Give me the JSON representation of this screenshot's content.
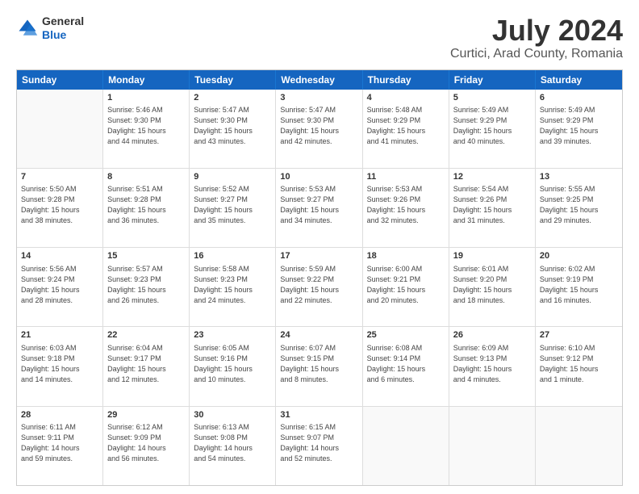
{
  "header": {
    "logo_general": "General",
    "logo_blue": "Blue",
    "main_title": "July 2024",
    "subtitle": "Curtici, Arad County, Romania"
  },
  "days_of_week": [
    "Sunday",
    "Monday",
    "Tuesday",
    "Wednesday",
    "Thursday",
    "Friday",
    "Saturday"
  ],
  "weeks": [
    [
      {
        "day": "",
        "info": ""
      },
      {
        "day": "1",
        "info": "Sunrise: 5:46 AM\nSunset: 9:30 PM\nDaylight: 15 hours\nand 44 minutes."
      },
      {
        "day": "2",
        "info": "Sunrise: 5:47 AM\nSunset: 9:30 PM\nDaylight: 15 hours\nand 43 minutes."
      },
      {
        "day": "3",
        "info": "Sunrise: 5:47 AM\nSunset: 9:30 PM\nDaylight: 15 hours\nand 42 minutes."
      },
      {
        "day": "4",
        "info": "Sunrise: 5:48 AM\nSunset: 9:29 PM\nDaylight: 15 hours\nand 41 minutes."
      },
      {
        "day": "5",
        "info": "Sunrise: 5:49 AM\nSunset: 9:29 PM\nDaylight: 15 hours\nand 40 minutes."
      },
      {
        "day": "6",
        "info": "Sunrise: 5:49 AM\nSunset: 9:29 PM\nDaylight: 15 hours\nand 39 minutes."
      }
    ],
    [
      {
        "day": "7",
        "info": "Sunrise: 5:50 AM\nSunset: 9:28 PM\nDaylight: 15 hours\nand 38 minutes."
      },
      {
        "day": "8",
        "info": "Sunrise: 5:51 AM\nSunset: 9:28 PM\nDaylight: 15 hours\nand 36 minutes."
      },
      {
        "day": "9",
        "info": "Sunrise: 5:52 AM\nSunset: 9:27 PM\nDaylight: 15 hours\nand 35 minutes."
      },
      {
        "day": "10",
        "info": "Sunrise: 5:53 AM\nSunset: 9:27 PM\nDaylight: 15 hours\nand 34 minutes."
      },
      {
        "day": "11",
        "info": "Sunrise: 5:53 AM\nSunset: 9:26 PM\nDaylight: 15 hours\nand 32 minutes."
      },
      {
        "day": "12",
        "info": "Sunrise: 5:54 AM\nSunset: 9:26 PM\nDaylight: 15 hours\nand 31 minutes."
      },
      {
        "day": "13",
        "info": "Sunrise: 5:55 AM\nSunset: 9:25 PM\nDaylight: 15 hours\nand 29 minutes."
      }
    ],
    [
      {
        "day": "14",
        "info": "Sunrise: 5:56 AM\nSunset: 9:24 PM\nDaylight: 15 hours\nand 28 minutes."
      },
      {
        "day": "15",
        "info": "Sunrise: 5:57 AM\nSunset: 9:23 PM\nDaylight: 15 hours\nand 26 minutes."
      },
      {
        "day": "16",
        "info": "Sunrise: 5:58 AM\nSunset: 9:23 PM\nDaylight: 15 hours\nand 24 minutes."
      },
      {
        "day": "17",
        "info": "Sunrise: 5:59 AM\nSunset: 9:22 PM\nDaylight: 15 hours\nand 22 minutes."
      },
      {
        "day": "18",
        "info": "Sunrise: 6:00 AM\nSunset: 9:21 PM\nDaylight: 15 hours\nand 20 minutes."
      },
      {
        "day": "19",
        "info": "Sunrise: 6:01 AM\nSunset: 9:20 PM\nDaylight: 15 hours\nand 18 minutes."
      },
      {
        "day": "20",
        "info": "Sunrise: 6:02 AM\nSunset: 9:19 PM\nDaylight: 15 hours\nand 16 minutes."
      }
    ],
    [
      {
        "day": "21",
        "info": "Sunrise: 6:03 AM\nSunset: 9:18 PM\nDaylight: 15 hours\nand 14 minutes."
      },
      {
        "day": "22",
        "info": "Sunrise: 6:04 AM\nSunset: 9:17 PM\nDaylight: 15 hours\nand 12 minutes."
      },
      {
        "day": "23",
        "info": "Sunrise: 6:05 AM\nSunset: 9:16 PM\nDaylight: 15 hours\nand 10 minutes."
      },
      {
        "day": "24",
        "info": "Sunrise: 6:07 AM\nSunset: 9:15 PM\nDaylight: 15 hours\nand 8 minutes."
      },
      {
        "day": "25",
        "info": "Sunrise: 6:08 AM\nSunset: 9:14 PM\nDaylight: 15 hours\nand 6 minutes."
      },
      {
        "day": "26",
        "info": "Sunrise: 6:09 AM\nSunset: 9:13 PM\nDaylight: 15 hours\nand 4 minutes."
      },
      {
        "day": "27",
        "info": "Sunrise: 6:10 AM\nSunset: 9:12 PM\nDaylight: 15 hours\nand 1 minute."
      }
    ],
    [
      {
        "day": "28",
        "info": "Sunrise: 6:11 AM\nSunset: 9:11 PM\nDaylight: 14 hours\nand 59 minutes."
      },
      {
        "day": "29",
        "info": "Sunrise: 6:12 AM\nSunset: 9:09 PM\nDaylight: 14 hours\nand 56 minutes."
      },
      {
        "day": "30",
        "info": "Sunrise: 6:13 AM\nSunset: 9:08 PM\nDaylight: 14 hours\nand 54 minutes."
      },
      {
        "day": "31",
        "info": "Sunrise: 6:15 AM\nSunset: 9:07 PM\nDaylight: 14 hours\nand 52 minutes."
      },
      {
        "day": "",
        "info": ""
      },
      {
        "day": "",
        "info": ""
      },
      {
        "day": "",
        "info": ""
      }
    ]
  ]
}
